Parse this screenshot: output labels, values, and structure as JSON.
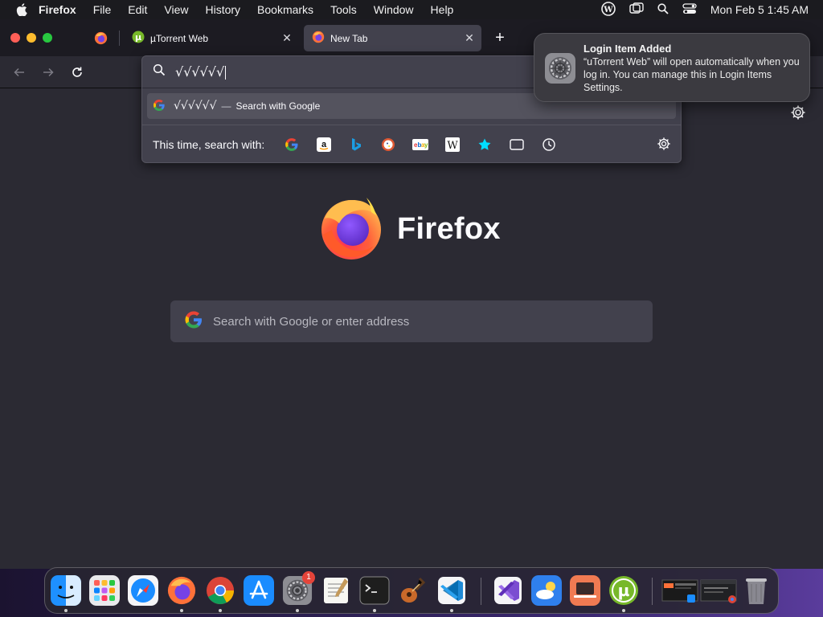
{
  "menubar": {
    "app_name": "Firefox",
    "items": [
      "File",
      "Edit",
      "View",
      "History",
      "Bookmarks",
      "Tools",
      "Window",
      "Help"
    ],
    "clock": "Mon Feb 5  1:45 AM"
  },
  "tabs": [
    {
      "label": "µTorrent Web",
      "icon": "utorrent-icon"
    },
    {
      "label": "New Tab",
      "icon": "firefox-icon",
      "active": true
    }
  ],
  "urlbar": {
    "typed_text": "√√√√√√",
    "suggestion": {
      "query": "√√√√√√",
      "separator": "—",
      "action": "Search with Google"
    },
    "one_off_label": "This time, search with:",
    "engines": [
      "google",
      "amazon",
      "bing",
      "duckduckgo",
      "ebay",
      "wikipedia",
      "bookmarks",
      "tabs",
      "history"
    ]
  },
  "home": {
    "wordmark": "Firefox",
    "search_placeholder": "Search with Google or enter address"
  },
  "notification": {
    "title": "Login Item Added",
    "body": "“uTorrent Web” will open automatically when you log in. You can manage this in Login Items Settings."
  },
  "dock": {
    "badge_count": "1",
    "apps": [
      "finder",
      "launchpad",
      "safari",
      "firefox",
      "chrome",
      "app-store",
      "system-settings",
      "textedit",
      "terminal",
      "garageband",
      "vscode",
      "visual-studio",
      "weather",
      "remote-desktop",
      "utorrent",
      "recent-window-1",
      "recent-window-2",
      "trash"
    ]
  },
  "colors": {
    "accent_blue": "#0a84ff",
    "toolbar": "#2b2a33",
    "tabbar": "#1c1b22",
    "field": "#42414d"
  }
}
